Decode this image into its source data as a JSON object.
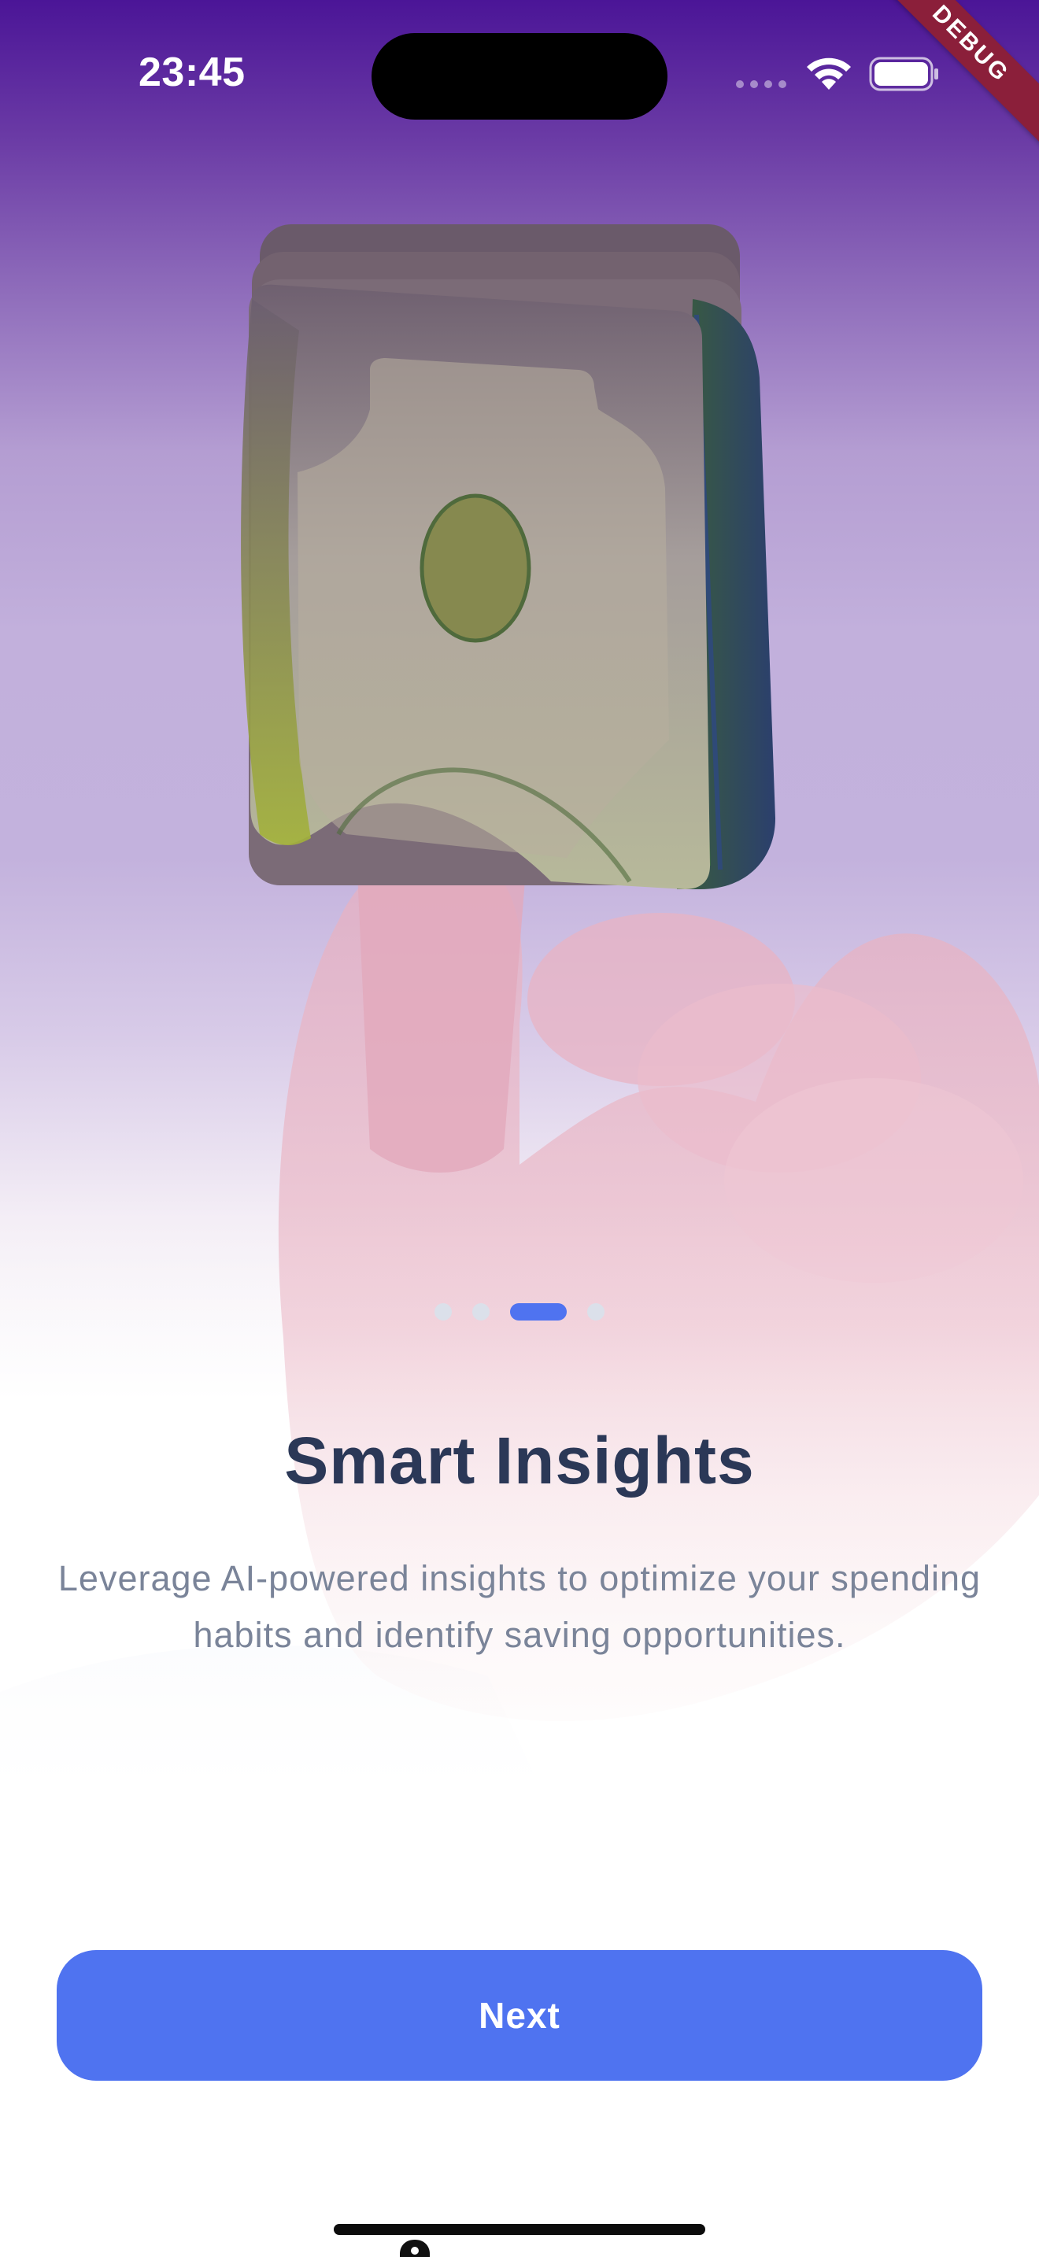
{
  "status_bar": {
    "time": "23:45",
    "icons": [
      "cellular-signal-icon",
      "wifi-icon",
      "battery-icon"
    ],
    "debug_banner": "DEBUG"
  },
  "illustration": {
    "icon": "hand-holding-cash-icon"
  },
  "page_indicator": {
    "total": 4,
    "active_index": 2
  },
  "onboarding": {
    "title": "Smart Insights",
    "description": "Leverage AI-powered insights to optimize your spending habits and identify saving opportunities."
  },
  "actions": {
    "next_label": "Next"
  },
  "colors": {
    "primary": "#4f73f0",
    "title": "#2b3857",
    "body_text": "#7a8499",
    "gradient_top": "#4b1597",
    "inactive_dot": "#dbe0ea"
  }
}
